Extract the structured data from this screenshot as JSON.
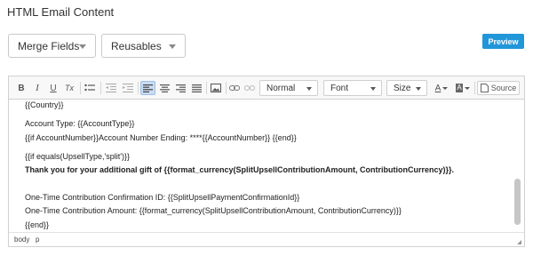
{
  "section_title": "HTML Email Content",
  "buttons": {
    "merge_fields": "Merge Fields",
    "reusables": "Reusables",
    "preview": "Preview"
  },
  "toolbar": {
    "bold": "B",
    "italic": "I",
    "underline": "U",
    "remove_format": "Tx",
    "format_combo": "Normal",
    "font_combo": "Font",
    "size_combo": "Size",
    "text_color": "A",
    "bg_color": "A",
    "source": "Source"
  },
  "content_lines": [
    "{{Country}}",
    "",
    "Account Type: {{AccountType}}",
    "{{if AccountNumber}}Account Number Ending: ****{{AccountNumber}} {{end}}",
    "",
    "{{if equals(UpsellType,'split')}}",
    "Thank you for your additional gift of {{format_currency(SplitUpsellContributionAmount, ContributionCurrency)}}.",
    "",
    "One-Time Contribution Confirmation ID: {{SplitUpsellPaymentConfirmationId}}",
    "One-Time Contribution Amount: {{format_currency(SplitUpsellContributionAmount, ContributionCurrency)}}",
    "{{end}}"
  ],
  "status_path": {
    "body": "body",
    "p": "p"
  },
  "colors": {
    "accent": "#2196d9",
    "active_button": "#c9dcf2"
  }
}
